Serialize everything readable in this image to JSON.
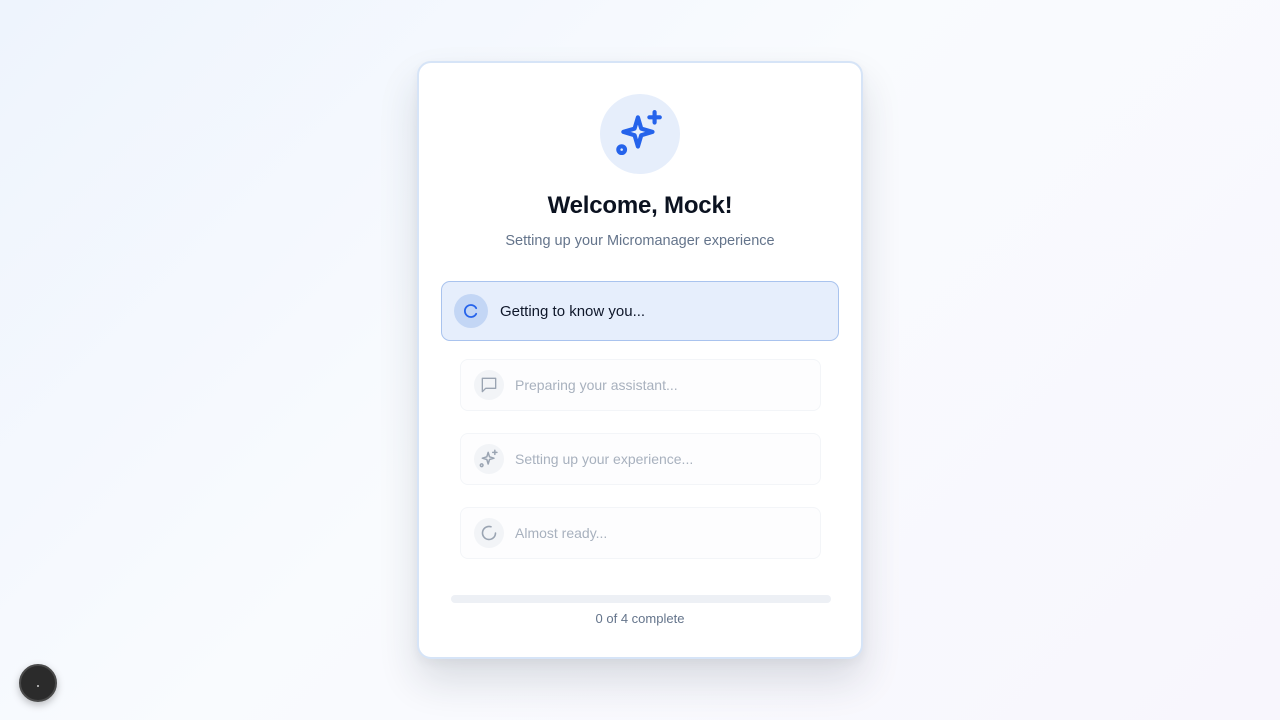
{
  "welcome": {
    "title": "Welcome, Mock!",
    "subtitle": "Setting up your Micromanager experience",
    "hero_icon": "sparkles-icon"
  },
  "steps": [
    {
      "label": "Getting to know you...",
      "icon": "spinner-icon",
      "state": "active"
    },
    {
      "label": "Preparing your assistant...",
      "icon": "chat-bubble-icon",
      "state": "pending"
    },
    {
      "label": "Setting up your experience...",
      "icon": "sparkles-icon",
      "state": "pending"
    },
    {
      "label": "Almost ready...",
      "icon": "spinner-icon",
      "state": "pending"
    }
  ],
  "progress": {
    "completed": 0,
    "total": 4,
    "fraction": 0,
    "text": "0 of 4 complete"
  },
  "colors": {
    "accent": "#2563eb",
    "active_step_bg": "#e6eefc",
    "muted_text": "#a8b1be"
  }
}
